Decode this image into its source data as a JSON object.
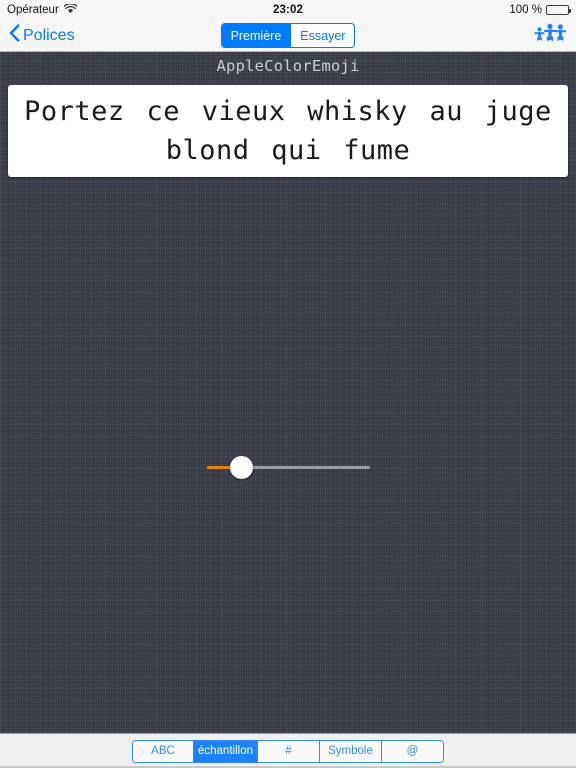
{
  "status_bar": {
    "carrier": "Opérateur",
    "wifi_icon": "wifi-icon",
    "time": "23:02",
    "battery_percent": "100 %",
    "battery_icon": "battery-full-icon"
  },
  "nav_bar": {
    "back_icon": "chevron-left-icon",
    "back_label": "Polices",
    "segments": [
      {
        "label": "Première",
        "selected": true
      },
      {
        "label": "Essayer",
        "selected": false
      }
    ],
    "right_icon": "family-group-icon"
  },
  "content": {
    "font_name": "AppleColorEmoji",
    "sample_text": "Portez ce vieux whisky au juge blond qui fume",
    "background_color": "#383c47",
    "card_background": "#ffffff"
  },
  "slider": {
    "name": "font-size-slider",
    "fill_color": "#e8820c",
    "track_color": "#9a9da4",
    "thumb_color": "#ffffff",
    "value_fraction": "0.21"
  },
  "bottom_bar": {
    "segments": [
      {
        "label": "ABC",
        "selected": false
      },
      {
        "label": "échantillon",
        "selected": true
      },
      {
        "label": "#",
        "selected": false
      },
      {
        "label": "Symbole",
        "selected": false
      },
      {
        "label": "@",
        "selected": false
      }
    ],
    "background_color": "#efeff4",
    "accent_color": "#1a82fb"
  }
}
